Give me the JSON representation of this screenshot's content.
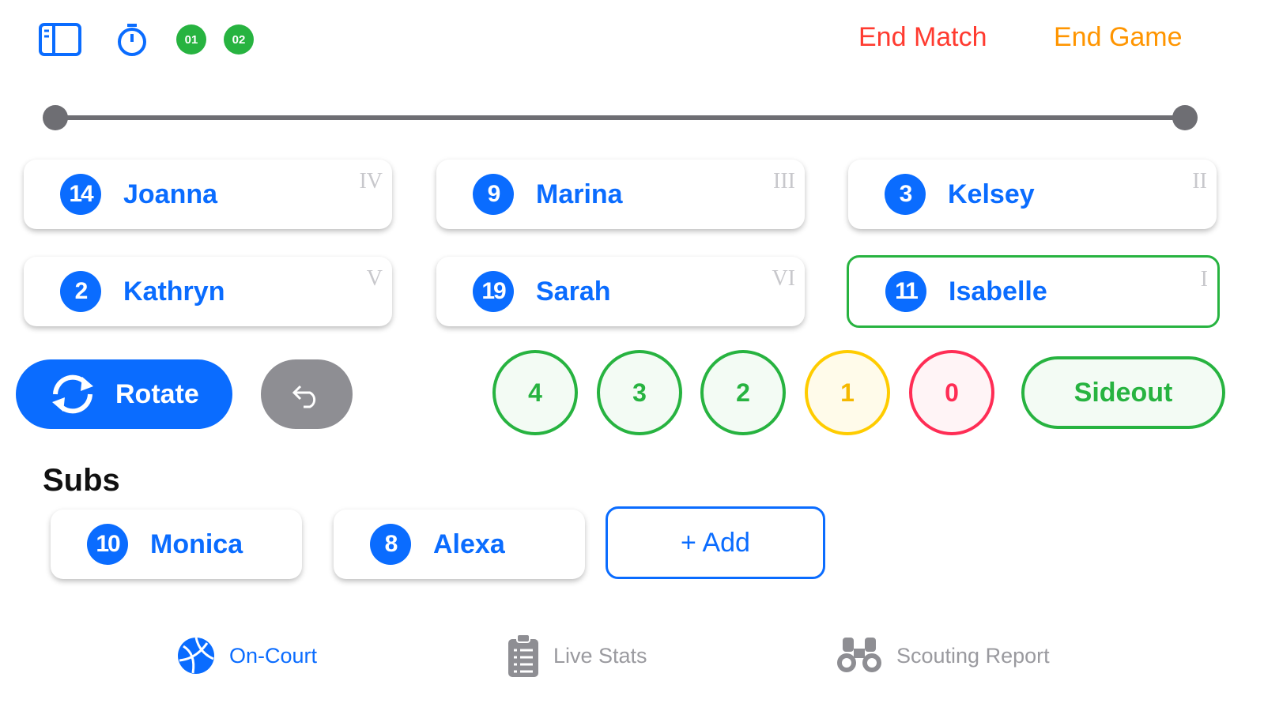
{
  "toolbar": {
    "sidebar_icon": "sidebar-icon",
    "timer_icon": "timer-icon",
    "sub_badges": [
      "01",
      "02"
    ],
    "end_match": "End Match",
    "end_game": "End Game"
  },
  "slider": {
    "value": 1.0
  },
  "court": [
    {
      "number": "14",
      "name": "Joanna",
      "position": "IV",
      "selected": false
    },
    {
      "number": "9",
      "name": "Marina",
      "position": "III",
      "selected": false
    },
    {
      "number": "3",
      "name": "Kelsey",
      "position": "II",
      "selected": false
    },
    {
      "number": "2",
      "name": "Kathryn",
      "position": "V",
      "selected": false
    },
    {
      "number": "19",
      "name": "Sarah",
      "position": "VI",
      "selected": false
    },
    {
      "number": "11",
      "name": "Isabelle",
      "position": "I",
      "selected": true
    }
  ],
  "actions": {
    "rotate": "Rotate",
    "undo_icon": "undo-icon"
  },
  "ratings": [
    "4",
    "3",
    "2",
    "1",
    "0"
  ],
  "sideout": "Sideout",
  "subs": {
    "title": "Subs",
    "players": [
      {
        "number": "10",
        "name": "Monica"
      },
      {
        "number": "8",
        "name": "Alexa"
      }
    ],
    "add_label": "+ Add"
  },
  "tabs": [
    {
      "label": "On-Court",
      "icon": "volleyball-icon",
      "active": true
    },
    {
      "label": "Live Stats",
      "icon": "clipboard-icon",
      "active": false
    },
    {
      "label": "Scouting Report",
      "icon": "binoculars-icon",
      "active": false
    }
  ],
  "colors": {
    "accent": "#0a6cff",
    "green": "#27b340",
    "yellow": "#ffcc00",
    "red": "#ff2d55",
    "orange": "#ff9500"
  }
}
